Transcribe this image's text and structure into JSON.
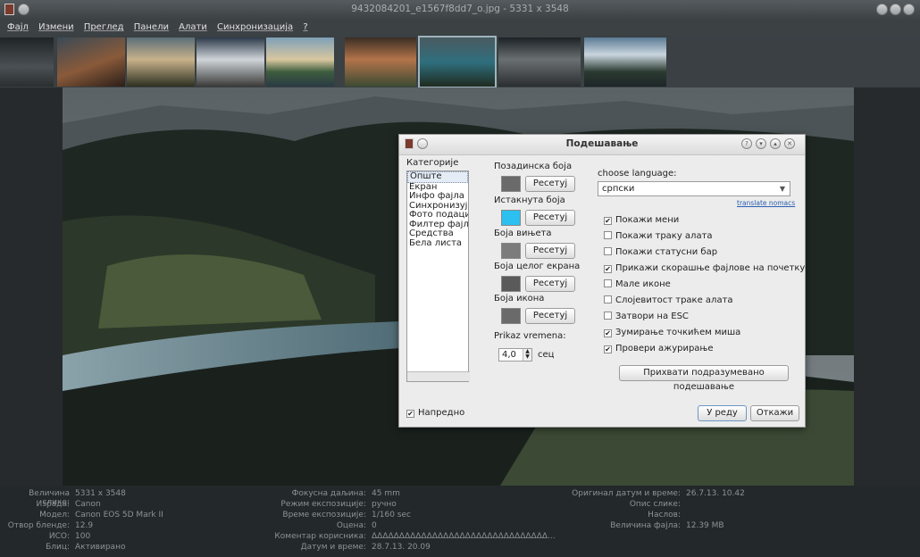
{
  "window": {
    "title": "9432084201_e1567f8dd7_o.jpg - 5331 x 3548"
  },
  "menu": [
    "Фајл",
    "Измени",
    "Преглед",
    "Панели",
    "Алати",
    "Синхронизација",
    "?"
  ],
  "dialog": {
    "title": "Подешавање",
    "categories_label": "Категорије",
    "categories": [
      "Опште",
      "Екран",
      "Инфо фајла",
      "Синхронизуј",
      "Фото подаци",
      "Филтер фајло",
      "Средства",
      "Бела листа"
    ],
    "advanced_label": "Напредно",
    "advanced_checked": true,
    "colors": [
      {
        "label": "Позадинска боја",
        "color": "#6a6a6a",
        "button": "Ресетуј"
      },
      {
        "label": "Истакнута боја",
        "color": "#2bc0f0",
        "button": "Ресетуј"
      },
      {
        "label": "Боја вињета",
        "color": "#7c7c7c",
        "button": "Ресетуј"
      },
      {
        "label": "Боја целог екрана",
        "color": "#5a5a5a",
        "button": "Ресетуј"
      },
      {
        "label": "Боја икона",
        "color": "#6a6a6a",
        "button": "Ресетуј"
      }
    ],
    "time_label": "Prikaz vremena:",
    "time_value": "4,0",
    "time_unit": "сец",
    "language_label": "choose language:",
    "language_value": "српски",
    "translate_link": "translate nomacs",
    "checkboxes": [
      {
        "label": "Покажи мени",
        "checked": true
      },
      {
        "label": "Покажи траку алата",
        "checked": false
      },
      {
        "label": "Покажи статусни бар",
        "checked": false
      },
      {
        "label": "Прикажи скорашње фајлове на почетку",
        "checked": true
      },
      {
        "label": "Мале иконе",
        "checked": false
      },
      {
        "label": "Слојевитост траке алата",
        "checked": false
      },
      {
        "label": "Затвори на ESC",
        "checked": false
      },
      {
        "label": "Зумирање точкићем миша",
        "checked": true
      },
      {
        "label": "Провери ажурирање",
        "checked": true
      }
    ],
    "defaults_button": "Прихвати подразумевано подешавање",
    "ok_button": "У реду",
    "cancel_button": "Откажи"
  },
  "info": {
    "col1": [
      {
        "k": "Величина слике:",
        "v": "5331 x 3548"
      },
      {
        "k": "Израда:",
        "v": "Canon"
      },
      {
        "k": "Модел:",
        "v": "Canon EOS 5D Mark II"
      },
      {
        "k": "Отвор бленде:",
        "v": "12.9"
      },
      {
        "k": "ИСО:",
        "v": "100"
      },
      {
        "k": "Блиц:",
        "v": "Активирано"
      }
    ],
    "col2": [
      {
        "k": "Фокусна даљина:",
        "v": "45 mm"
      },
      {
        "k": "Режим експозиције:",
        "v": "ручно"
      },
      {
        "k": "Време експозиције:",
        "v": "1/160 sec"
      },
      {
        "k": "Оцена:",
        "v": "0"
      },
      {
        "k": "Коментар корисника:",
        "v": "ΔΔΔΔΔΔΔΔΔΔΔΔΔΔΔΔΔΔΔΔΔΔΔΔΔΔΔΔΔΔΔΔ..."
      },
      {
        "k": "Датум и време:",
        "v": "28.7.13. 20.09"
      }
    ],
    "col3": [
      {
        "k": "Оригинал датум и време:",
        "v": "26.7.13. 10.42"
      },
      {
        "k": "Опис слике:",
        "v": ""
      },
      {
        "k": "Наслов:",
        "v": ""
      },
      {
        "k": "Величина фајла:",
        "v": "12.39 MB"
      }
    ]
  }
}
